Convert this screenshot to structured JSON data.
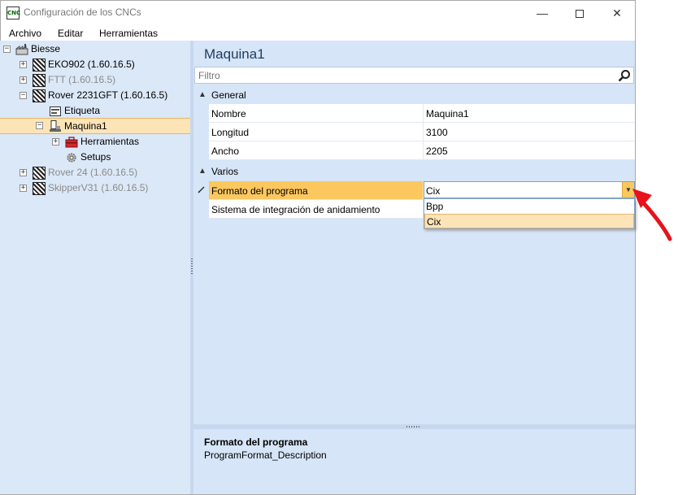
{
  "window": {
    "app_icon_text": "CNC",
    "title": "Configuración de los CNCs",
    "minimize": "—",
    "close": "✕"
  },
  "menu": [
    "Archivo",
    "Editar",
    "Herramientas"
  ],
  "tree": {
    "root": "Biesse",
    "nodes": [
      {
        "label": "EKO902 (1.60.16.5)",
        "state": "collapsed"
      },
      {
        "label": "FTT (1.60.16.5)",
        "state": "collapsed",
        "disabled": true
      },
      {
        "label": "Rover 2231GFT (1.60.16.5)",
        "state": "expanded"
      },
      {
        "label": "Etiqueta"
      },
      {
        "label": "Maquina1",
        "state": "expanded",
        "selected": true
      },
      {
        "label": "Herramientas",
        "state": "collapsed"
      },
      {
        "label": "Setups"
      },
      {
        "label": "Rover 24 (1.60.16.5)",
        "state": "collapsed",
        "disabled": true
      },
      {
        "label": "SkipperV31 (1.60.16.5)",
        "state": "collapsed",
        "disabled": true
      }
    ]
  },
  "right": {
    "title": "Maquina1",
    "filter_placeholder": "Filtro",
    "sections": {
      "general": {
        "label": "General",
        "rows": [
          {
            "name": "Nombre",
            "value": "Maquina1"
          },
          {
            "name": "Longitud",
            "value": "3100"
          },
          {
            "name": "Ancho",
            "value": "2205"
          }
        ]
      },
      "varios": {
        "label": "Varios",
        "rows": [
          {
            "name": "Formato del programa",
            "value": "Cix"
          },
          {
            "name": "Sistema de integración de anidamiento",
            "value": ""
          }
        ]
      }
    },
    "dropdown_options": [
      "Bpp",
      "Cix"
    ],
    "dropdown_selected": "Cix"
  },
  "description": {
    "title": "Formato del programa",
    "text": "ProgramFormat_Description"
  },
  "colors": {
    "selection": "#fce4b7",
    "active_row": "#fbc75e",
    "panel": "#d6e5f7",
    "annotation_arrow": "#e8121b"
  }
}
